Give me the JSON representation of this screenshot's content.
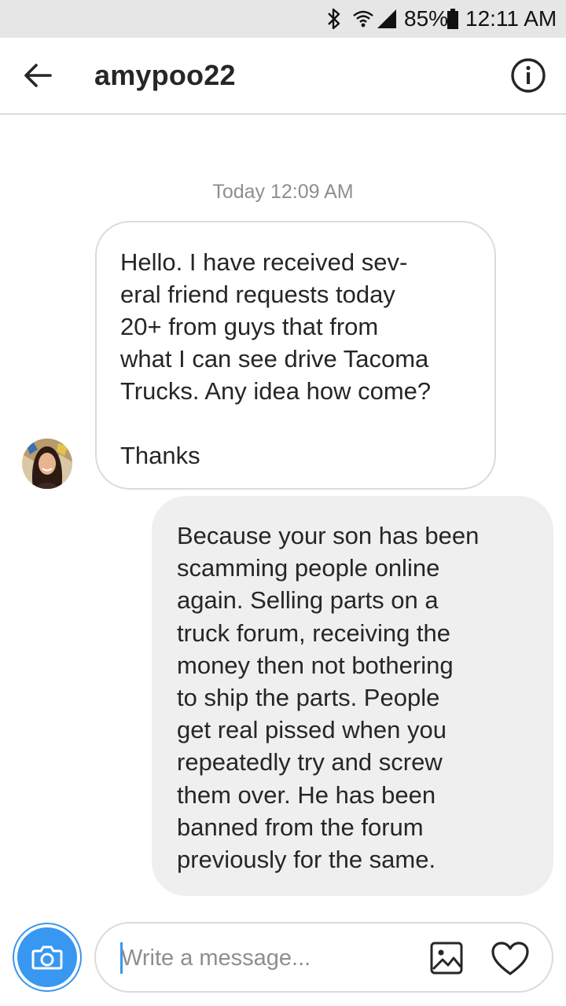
{
  "status_bar": {
    "battery": "85%",
    "time": "12:11 AM",
    "icons": [
      "bluetooth-icon",
      "wifi-icon",
      "signal-icon",
      "battery-icon"
    ]
  },
  "header": {
    "username": "amypoo22",
    "icons": [
      "back-arrow-icon",
      "info-icon"
    ]
  },
  "conversation": {
    "timestamp": "Today 12:09 AM",
    "messages": [
      {
        "sender": "amypoo22",
        "text": "Hello. I have received sev-\neral friend requests today\n20+ from guys that from\nwhat I can see drive Tacoma\nTrucks. Any idea how come?\n\nThanks"
      },
      {
        "sender": "self",
        "text": "Because your son has been\nscamming people online\nagain. Selling parts on a\ntruck forum, receiving the\nmoney then not bothering\nto ship the parts. People\nget real pissed when you\nrepeatedly try and screw\nthem over. He has been\nbanned from the forum\npreviously for the same."
      }
    ]
  },
  "composer": {
    "placeholder": "Write a message...",
    "value": "",
    "icons": [
      "camera-icon",
      "gallery-icon",
      "heart-icon"
    ]
  },
  "colors": {
    "accent": "#3897f0",
    "outgoing_bubble": "#efefef",
    "border": "#dbdbdb",
    "muted_text": "#8e8e8e"
  }
}
